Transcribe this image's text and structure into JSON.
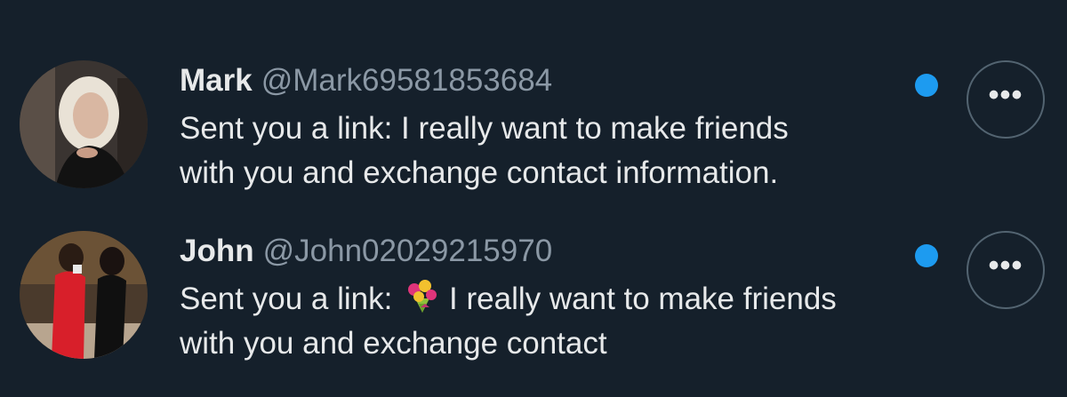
{
  "conversations": [
    {
      "display_name": "Mark",
      "handle": "@Mark69581853684",
      "preview_line_1": "Sent you a link: I really want to make friends",
      "preview_line_2": "with you and exchange contact information.",
      "unread": true,
      "avatar_icon": "user-photo-blonde-woman"
    },
    {
      "display_name": "John",
      "handle": "@John02029215970",
      "preview_prefix": "Sent you a link:",
      "preview_emoji": "💐",
      "preview_suffix": "I really want to make friends",
      "preview_line_2": "with you and exchange contact",
      "unread": true,
      "avatar_icon": "user-photo-two-women"
    }
  ],
  "more_label": "•••",
  "colors": {
    "background": "#15202b",
    "text_primary": "#e7e9ea",
    "text_secondary": "#8b98a5",
    "unread_dot": "#1d9bf0",
    "button_border": "#536471"
  }
}
